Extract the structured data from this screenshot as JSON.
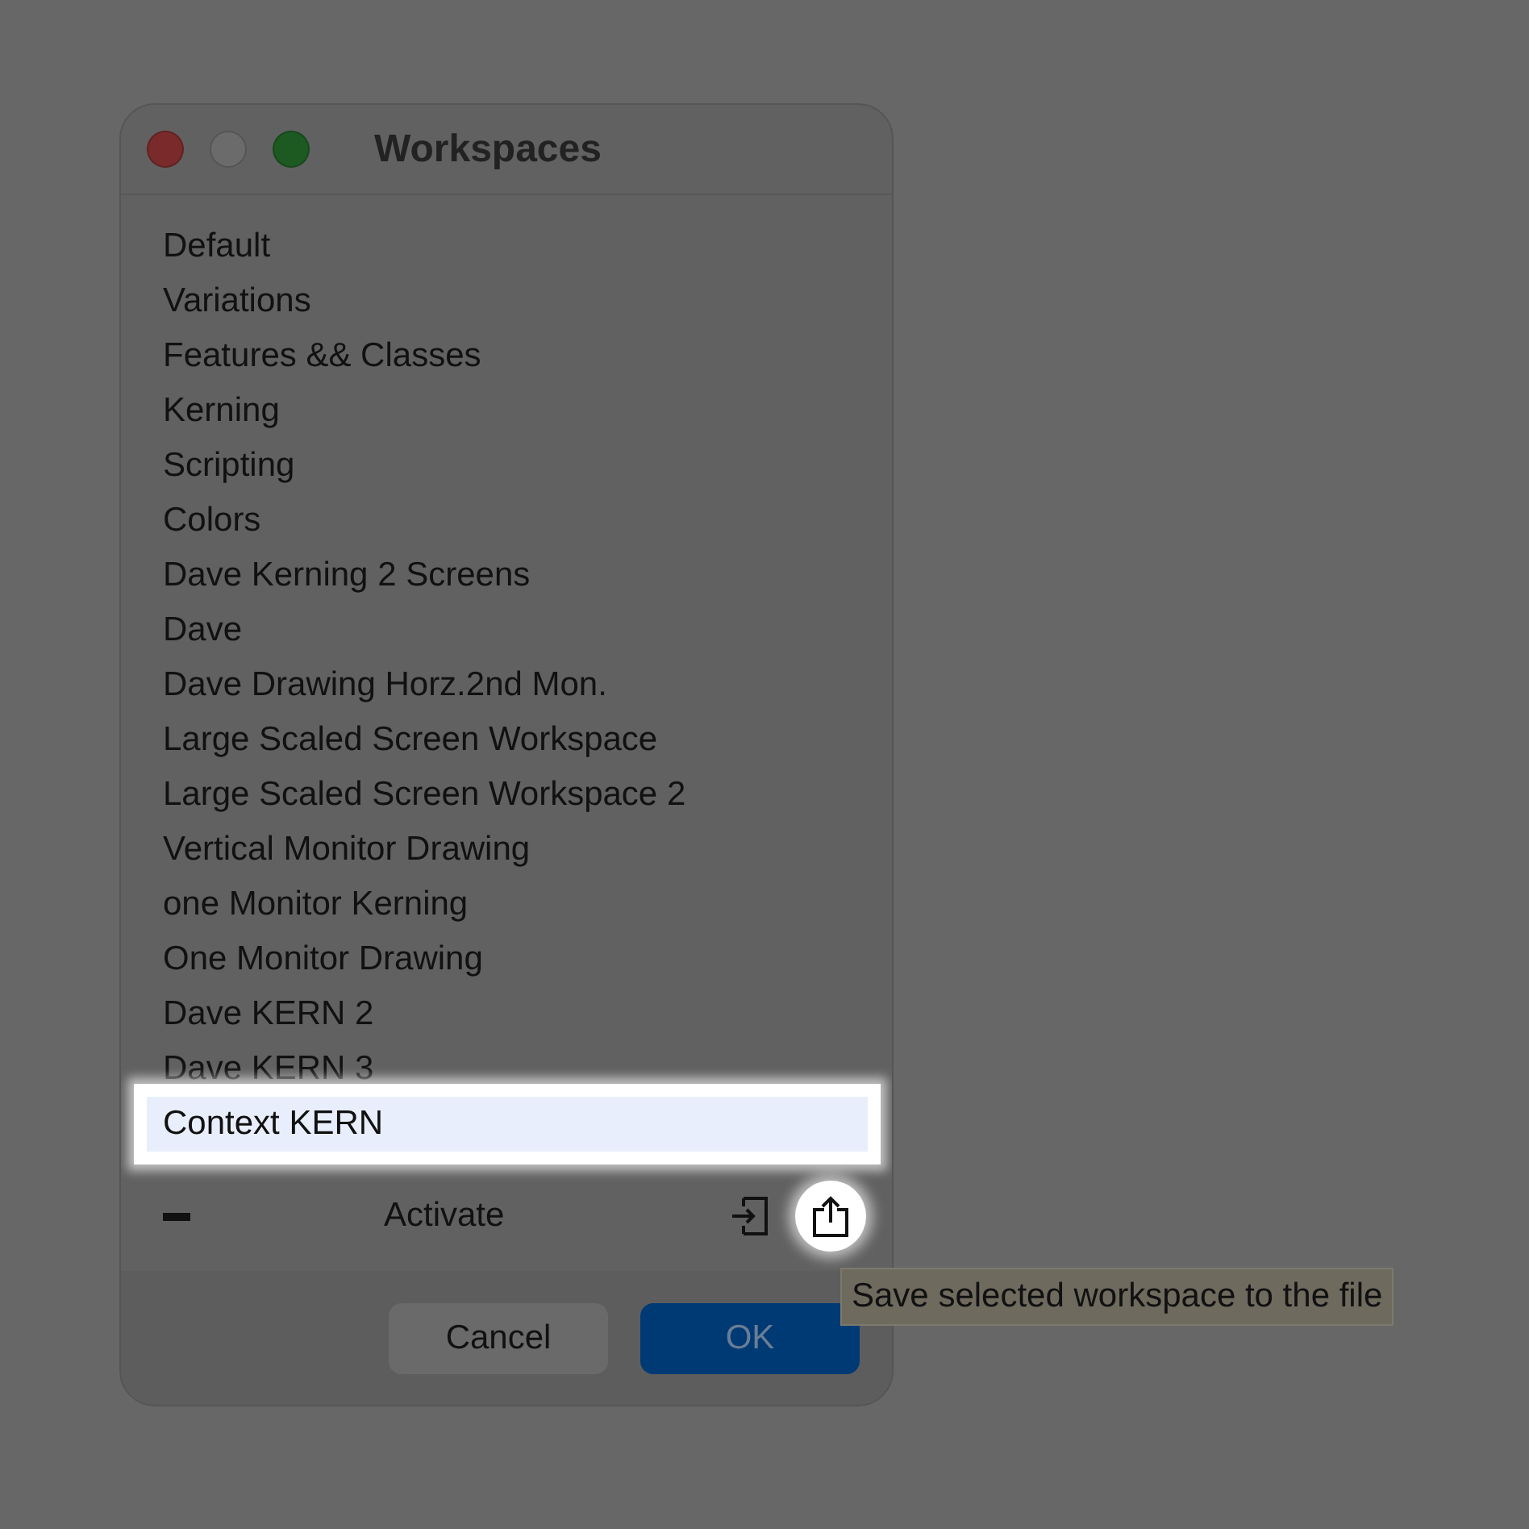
{
  "window": {
    "title": "Workspaces"
  },
  "workspaces": [
    {
      "label": "Default",
      "selected": false
    },
    {
      "label": "Variations",
      "selected": false
    },
    {
      "label": "Features && Classes",
      "selected": false
    },
    {
      "label": "Kerning",
      "selected": false
    },
    {
      "label": "Scripting",
      "selected": false
    },
    {
      "label": "Colors",
      "selected": false
    },
    {
      "label": "Dave Kerning 2 Screens",
      "selected": false
    },
    {
      "label": "Dave",
      "selected": false
    },
    {
      "label": "Dave Drawing Horz.2nd Mon.",
      "selected": false
    },
    {
      "label": "Large Scaled Screen Workspace",
      "selected": false
    },
    {
      "label": "Large Scaled Screen Workspace 2",
      "selected": false
    },
    {
      "label": "Vertical Monitor Drawing",
      "selected": false
    },
    {
      "label": "one Monitor Kerning",
      "selected": false
    },
    {
      "label": "One Monitor Drawing",
      "selected": false
    },
    {
      "label": "Dave KERN 2",
      "selected": false
    },
    {
      "label": "Dave KERN 3",
      "selected": false
    },
    {
      "label": "Context KERN",
      "selected": true
    }
  ],
  "toolbar": {
    "activate": "Activate"
  },
  "buttons": [
    {
      "label": "Cancel",
      "kind": "secondary"
    },
    {
      "label": "OK",
      "kind": "primary"
    }
  ],
  "tooltip": "Save selected workspace to the file"
}
